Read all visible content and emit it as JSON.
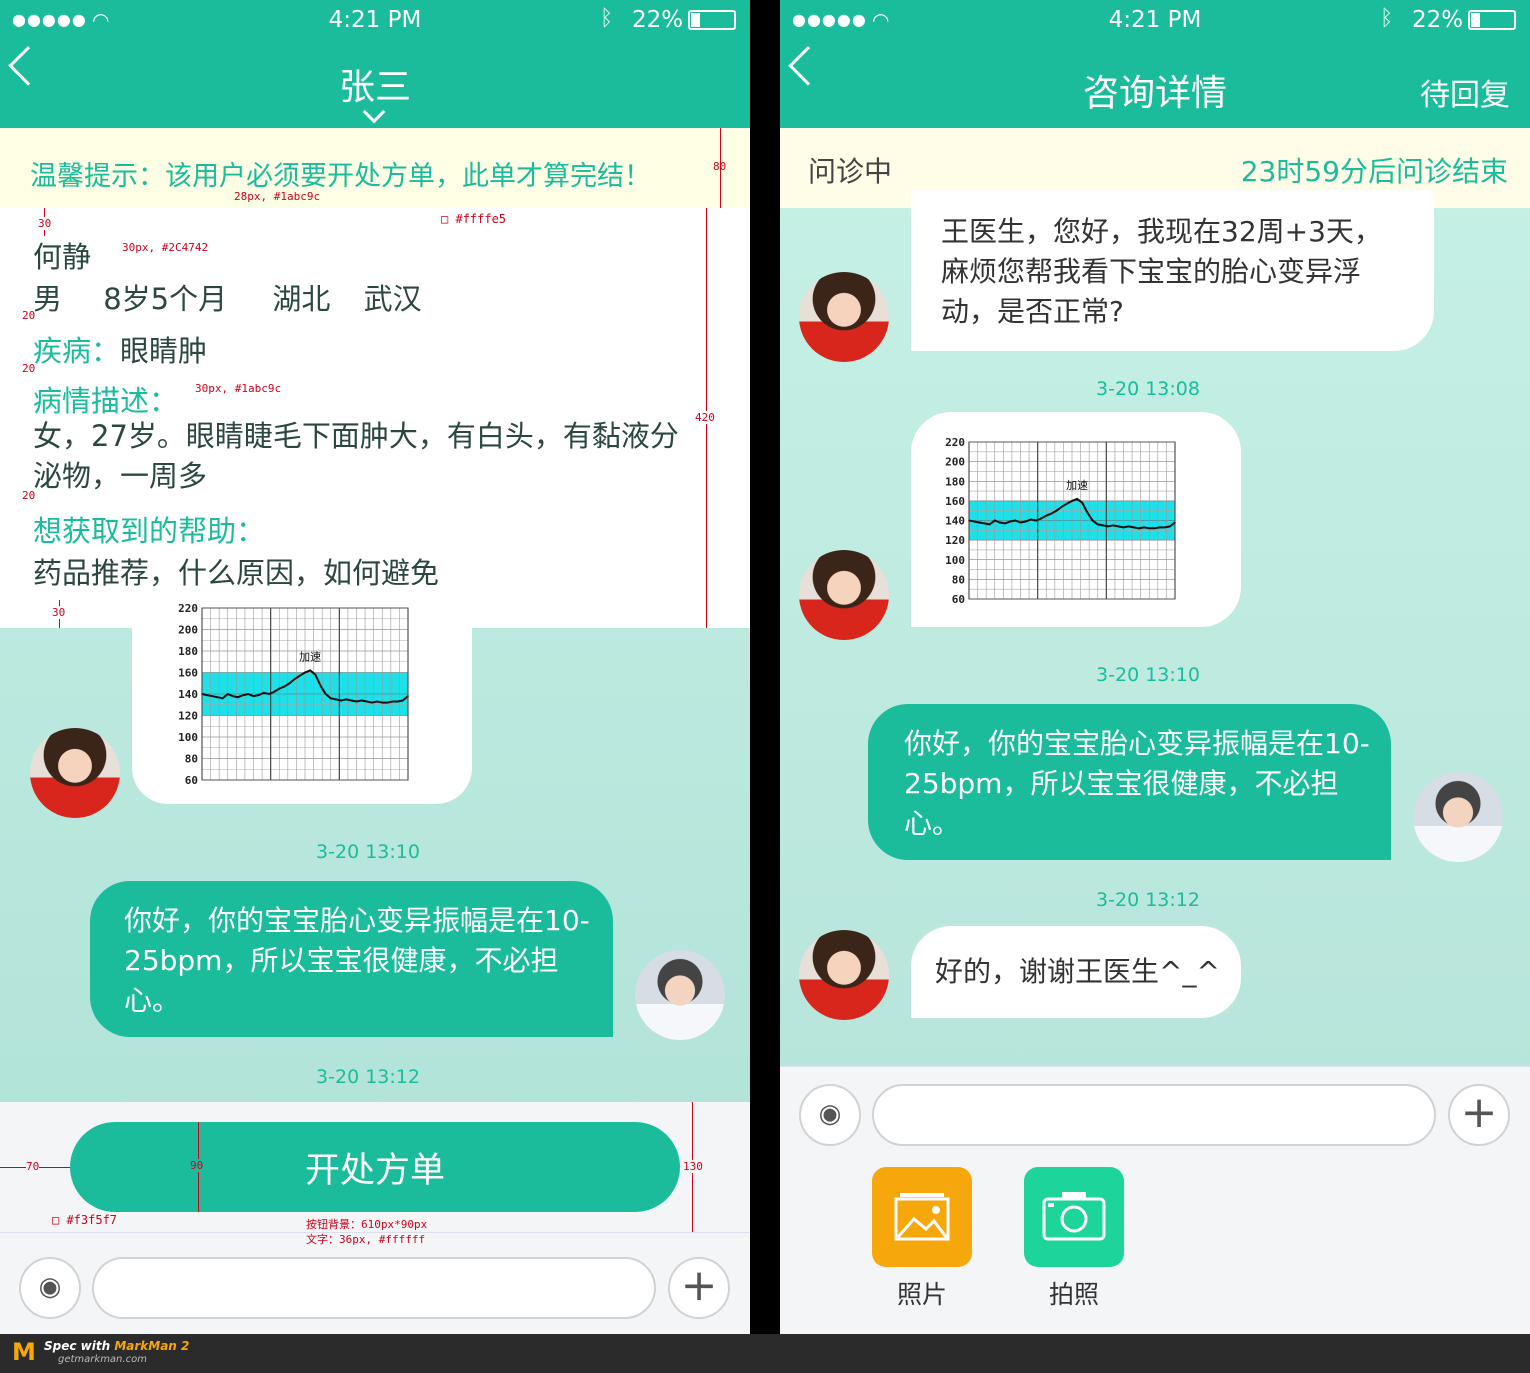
{
  "status": {
    "time": "4:21 PM",
    "battery": "22%",
    "signal": "●●●●●"
  },
  "left": {
    "title": "张三",
    "tip": "温馨提示：该用户必须要开处方单，此单才算完结！",
    "patient": {
      "name": "何静",
      "gender": "男",
      "age": "8岁5个月",
      "province": "湖北",
      "city": "武汉"
    },
    "disease_label": "疾病：",
    "disease_value": "眼睛肿",
    "desc_label": "病情描述：",
    "desc_value": "女，27岁。眼睛睫毛下面肿大，有白头，有黏液分泌物，一周多",
    "help_label": "想获取到的帮助：",
    "help_value": "药品推荐，什么原因，如何避免",
    "ts1": "3-20 13:10",
    "doctor_msg": "你好，你的宝宝胎心变异振幅是在10-25bpm，所以宝宝很健康，不必担心。",
    "ts2": "3-20 13:12",
    "prescribe_button": "开处方单",
    "annotations": {
      "a30_top": "30",
      "a_tip": "28px, #1abc9c",
      "a_bg": "#ffffe5",
      "a80": "80",
      "a_name": "30px, #2C4742",
      "a20_1": "20",
      "a20_2": "20",
      "a_label": "30px, #1abc9c",
      "a420": "420",
      "a20_3": "20",
      "a30_bottom": "30",
      "a70": "70",
      "a90": "90",
      "a130": "130",
      "a_panel": "#f3f5f7",
      "a_btn1": "按钮背景：610px*90px",
      "a_btn2": "文字：36px, #ffffff"
    }
  },
  "right": {
    "title": "咨询详情",
    "action": "待回复",
    "status_label": "问诊中",
    "countdown": "23时59分后问诊结束",
    "patient_msg": "王医生，您好，我现在32周+3天，麻烦您帮我看下宝宝的胎心变异浮动，是否正常?",
    "ts1": "3-20 13:08",
    "ts2": "3-20 13:10",
    "doctor_msg": "你好，你的宝宝胎心变异振幅是在10-25bpm，所以宝宝很健康，不必担心。",
    "ts3": "3-20 13:12",
    "patient_msg2": "好的，谢谢王医生^_^",
    "tools": [
      {
        "label": "照片",
        "icon": "photo-icon",
        "color": "#f5a70b"
      },
      {
        "label": "拍照",
        "icon": "camera-icon",
        "color": "#1dd49b"
      }
    ]
  },
  "chart_data": {
    "type": "line",
    "title": "",
    "annotation": "加速",
    "y_ticks": [
      220,
      200,
      180,
      160,
      140,
      120,
      100,
      80,
      60
    ],
    "ylim": [
      60,
      220
    ],
    "normal_band": [
      120,
      160
    ],
    "x": [
      0,
      1,
      2,
      3,
      4,
      5,
      6,
      7,
      8,
      9,
      10,
      11,
      12,
      13,
      14,
      15,
      16,
      17,
      18,
      19,
      20,
      21,
      22,
      23,
      24,
      25,
      26,
      27,
      28,
      29,
      30,
      31,
      32,
      33,
      34,
      35,
      36,
      37,
      38,
      39,
      40
    ],
    "values": [
      140,
      139,
      138,
      137,
      136,
      140,
      138,
      137,
      139,
      140,
      138,
      139,
      141,
      140,
      142,
      145,
      147,
      150,
      154,
      157,
      160,
      162,
      158,
      148,
      140,
      136,
      135,
      134,
      135,
      134,
      133,
      134,
      133,
      132,
      133,
      132,
      132,
      133,
      133,
      134,
      138
    ]
  },
  "footer": {
    "brand": "Spec with",
    "brand2": "MarkMan 2",
    "url": "getmarkman.com"
  }
}
